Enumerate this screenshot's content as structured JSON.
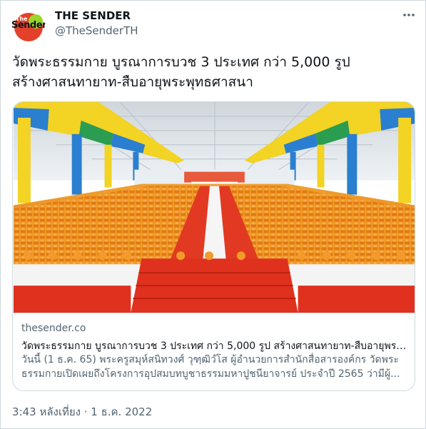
{
  "author": {
    "name": "THE SENDER",
    "handle": "@TheSenderTH",
    "avatar_text": "Sender",
    "avatar_small_text": "The"
  },
  "tweet": {
    "line1": "วัดพระธรรมกาย บูรณาการบวช 3 ประเทศ กว่า 5,000 รูป",
    "line2": "สร้างศาสนทายาท-สืบอายุพระพุทธศาสนา",
    "timestamp": "3:43 หลังเที่ยง · 1 ธ.ค. 2022"
  },
  "card": {
    "domain": "thesender.co",
    "title": "วัดพระธรรมกาย บูรณาการบวช 3 ประเทศ กว่า 5,000 รูป สร้างศาสนทายาท-สืบอายุพระ...",
    "description_line1": "วันนี้ (1 ธ.ค. 65) พระครูสมุห์สนิทวงศ์ วุฑฺฒิวํโส ผู้อำนวยการสำนักสื่อสารองค์กร วัดพระ",
    "description_line2": "ธรรมกายเปิดเผยถึงโครงการอุปสมบทบูชาธรรมมหาปูชนียาจารย์ ประจำปี 2565 ว่ามีผู้..."
  },
  "icons": {
    "more": "more-icon"
  },
  "colors": {
    "text_primary": "#0f1419",
    "text_secondary": "#536471",
    "border": "#cfd9de",
    "robe_orange": "#f08a1c",
    "carpet_red": "#e0311e"
  }
}
